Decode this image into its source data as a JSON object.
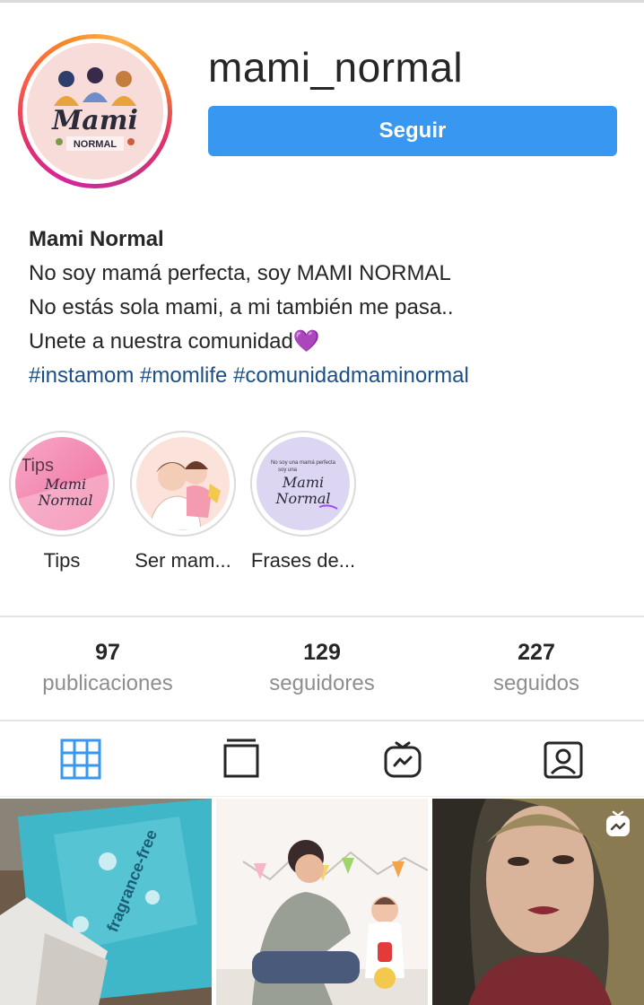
{
  "profile": {
    "username": "mami_normal",
    "follow_label": "Seguir",
    "avatar_logo_text": "Mami NORMAL"
  },
  "bio": {
    "name": "Mami Normal",
    "line1": "No soy mamá perfecta, soy MAMI NORMAL",
    "line2": "No estás sola mami, a mi también me pasa..",
    "line3": "Unete a nuestra comunidad",
    "line3_emoji": "💜",
    "hashtags": "#instamom #momlife #comunidadmaminormal"
  },
  "highlights": [
    {
      "label": "Tips",
      "cover_text": "Tips Mami Normal"
    },
    {
      "label": "Ser mam..."
    },
    {
      "label": "Frases de...",
      "cover_text": "No soy una mamá perfecta soy una Mami Normal"
    }
  ],
  "stats": {
    "posts_count": "97",
    "posts_label": "publicaciones",
    "followers_count": "129",
    "followers_label": "seguidores",
    "following_count": "227",
    "following_label": "seguidos"
  },
  "tabs": [
    {
      "name": "grid-icon",
      "active": true
    },
    {
      "name": "feed-list-icon",
      "active": false
    },
    {
      "name": "igtv-icon",
      "active": false
    },
    {
      "name": "tagged-icon",
      "active": false
    }
  ],
  "posts": [
    {
      "subject": "diaper pack",
      "overlay_text": "fragrance-free"
    },
    {
      "subject": "mother and baby playing"
    },
    {
      "subject": "selfie",
      "badge": "igtv-icon"
    }
  ],
  "colors": {
    "accent": "#3897f0",
    "hashtag": "#1c4f85",
    "muted": "#8e8e8e",
    "active_tab": "#3897f0"
  }
}
